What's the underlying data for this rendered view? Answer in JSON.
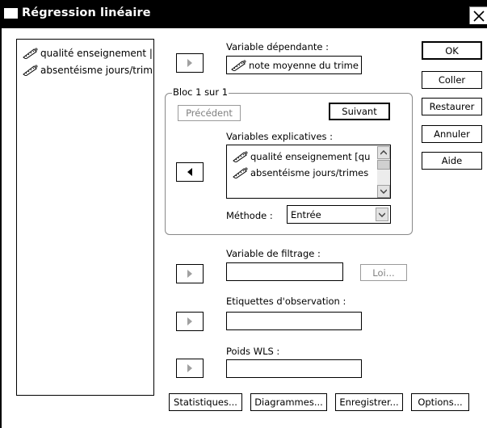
{
  "window": {
    "title": "Régression linéaire",
    "close_label": "X"
  },
  "source_list": {
    "items": [
      {
        "label": "qualité enseignement |",
        "icon": "ruler-pencil-icon"
      },
      {
        "label": "absentéisme jours/trim",
        "icon": "ruler-pencil-icon"
      }
    ]
  },
  "dependent": {
    "label": "Variable dépendante :",
    "value": "note moyenne du trime"
  },
  "block": {
    "legend": "Bloc 1 sur 1",
    "previous_label": "Précédent",
    "next_label": "Suivant",
    "independents_label": "Variables explicatives :",
    "independents": [
      {
        "label": "qualité enseignement [qu"
      },
      {
        "label": "absentéisme jours/trimes"
      }
    ],
    "method_label": "Méthode :",
    "method_value": "Entrée"
  },
  "filter": {
    "label": "Variable de filtrage :",
    "value": "",
    "rule_label": "Loi..."
  },
  "case_labels": {
    "label": "Etiquettes d'observation :",
    "value": ""
  },
  "wls": {
    "label": "Poids WLS :",
    "value": ""
  },
  "side_buttons": {
    "ok": "OK",
    "paste": "Coller",
    "reset": "Restaurer",
    "cancel": "Annuler",
    "help": "Aide"
  },
  "bottom_buttons": {
    "statistics": "Statistiques...",
    "plots": "Diagrammes...",
    "save": "Enregistrer...",
    "options": "Options..."
  },
  "colors": {
    "titlebar": "#000000",
    "disabled_text": "#808080",
    "border": "#000000"
  }
}
